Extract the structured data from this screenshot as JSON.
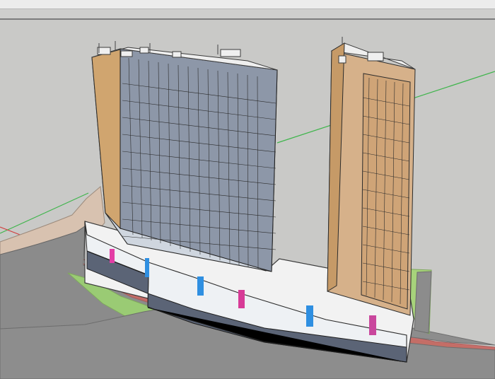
{
  "app": {
    "window_kind": "3D modeling viewport",
    "toolbar_icons": []
  },
  "viewport": {
    "background_color": "#c9c9c7",
    "scene": {
      "axes": {
        "x_color": "#d23d3d",
        "y_color": "#3fb54c",
        "z_color": "#2f4fd8"
      },
      "materials": {
        "ground": "#c8c8c6",
        "road": "#8d8d8d",
        "plaza": "#d8c2b0",
        "green_edge": "#9acb74",
        "red_paving": "#c76a66",
        "podium_glass": "#5b6476",
        "tower_facade_light": "#d4b081",
        "tower_facade_dark": "#8c8c8c",
        "window_blue": "#7e98c7",
        "roof": "#f2f2f2"
      }
    }
  }
}
